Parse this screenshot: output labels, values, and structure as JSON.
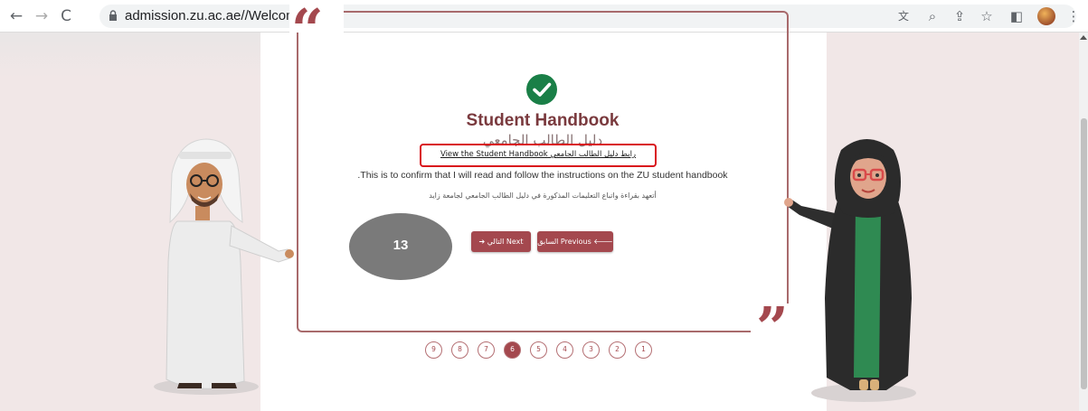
{
  "browser": {
    "back_icon": "back-arrow-icon",
    "forward_icon": "forward-arrow-icon",
    "reload_icon": "reload-icon",
    "url": "admission.zu.ac.ae//Welcome",
    "tools": [
      "translate-icon",
      "zoom-icon",
      "share-icon",
      "bookmark-star-icon",
      "side-panel-icon",
      "profile-avatar",
      "menu-icon"
    ]
  },
  "card": {
    "title_en": "Student Handbook",
    "title_ar": "دليل الطالب الجامعي",
    "handbook_link": "View the Student Handbook رابط دليل الطالب الجامعي",
    "confirm_en": ".This is to confirm that I will read and follow the instructions on the ZU student handbook",
    "confirm_ar": "أتعهد بقراءة واتباع التعليمات المذكورة في دليل الطالب الجامعي لجامعة زايد",
    "next_label": "➔ التالي Next",
    "previous_label": "السابق Previous 🡐"
  },
  "step_badge": "13",
  "steps": {
    "items": [
      "9",
      "8",
      "7",
      "6",
      "5",
      "4",
      "3",
      "2",
      "1"
    ],
    "active": "6"
  },
  "colors": {
    "brand": "#a4484e",
    "frame": "#a86a6c",
    "highlight_box": "#d9141c",
    "check": "#1a7f47",
    "badge": "#7a7a7a"
  }
}
